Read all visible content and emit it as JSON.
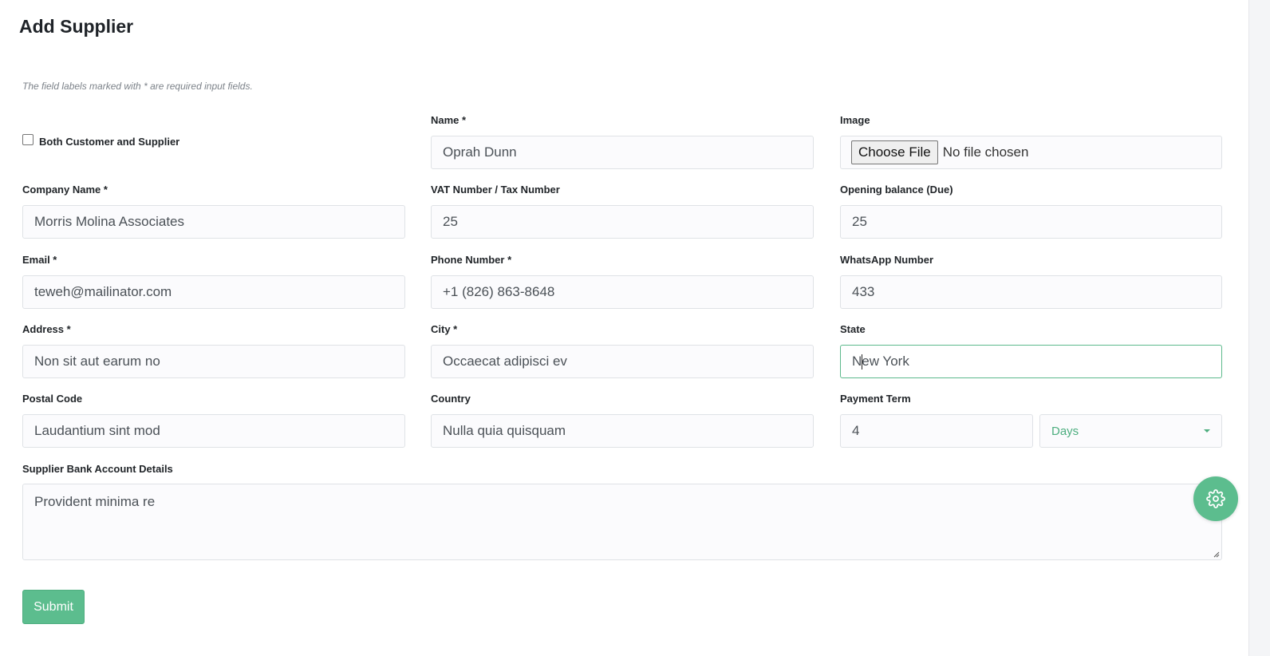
{
  "page": {
    "title": "Add Supplier",
    "required_note": "The field labels marked with * are required input fields."
  },
  "form": {
    "both_customer_supplier": {
      "label": "Both Customer and Supplier",
      "checked": false
    },
    "name": {
      "label": "Name *",
      "value": "Oprah Dunn"
    },
    "image": {
      "label": "Image",
      "button": "Choose File",
      "status": "No file chosen"
    },
    "company_name": {
      "label": "Company Name *",
      "value": "Morris Molina Associates"
    },
    "vat_number": {
      "label": "VAT Number / Tax Number",
      "value": "25"
    },
    "opening_balance": {
      "label": "Opening balance (Due)",
      "value": "25"
    },
    "email": {
      "label": "Email *",
      "value": "teweh@mailinator.com"
    },
    "phone": {
      "label": "Phone Number *",
      "value": "+1 (826) 863-8648"
    },
    "whatsapp": {
      "label": "WhatsApp Number",
      "value": "433"
    },
    "address": {
      "label": "Address *",
      "value": "Non sit aut earum no"
    },
    "city": {
      "label": "City *",
      "value": "Occaecat adipisci ev"
    },
    "state": {
      "label": "State",
      "value_before_caret": "N",
      "value_after_caret": "ew York"
    },
    "postal_code": {
      "label": "Postal Code",
      "value": "Laudantium sint mod"
    },
    "country": {
      "label": "Country",
      "value": "Nulla quia quisquam"
    },
    "payment_term": {
      "label": "Payment Term",
      "value": "4",
      "unit": "Days"
    },
    "bank_details": {
      "label": "Supplier Bank Account Details",
      "value": "Provident minima re"
    },
    "submit_label": "Submit"
  },
  "colors": {
    "accent": "#5cbd8e",
    "focus_border": "#5cb98c"
  },
  "icons": {
    "settings": "gear-icon",
    "select_arrow": "chevron-down-icon"
  }
}
